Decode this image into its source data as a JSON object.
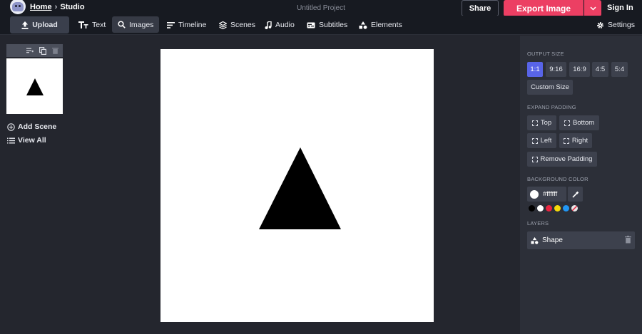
{
  "header": {
    "breadcrumb_home": "Home",
    "breadcrumb_separator": "›",
    "breadcrumb_current": "Studio",
    "project_title": "Untitled Project",
    "share_label": "Share",
    "export_label": "Export Image",
    "signin_label": "Sign In"
  },
  "toolbar": {
    "upload_label": "Upload",
    "items": [
      {
        "label": "Text",
        "icon": "text-icon"
      },
      {
        "label": "Images",
        "icon": "search-icon",
        "active": true
      },
      {
        "label": "Timeline",
        "icon": "timeline-icon"
      },
      {
        "label": "Scenes",
        "icon": "layers-icon"
      },
      {
        "label": "Audio",
        "icon": "music-note-icon"
      },
      {
        "label": "Subtitles",
        "icon": "subtitles-icon"
      },
      {
        "label": "Elements",
        "icon": "shapes-icon"
      }
    ],
    "settings_label": "Settings"
  },
  "scenes": {
    "add_scene_label": "Add Scene",
    "view_all_label": "View All"
  },
  "panel": {
    "output_size_label": "OUTPUT SIZE",
    "sizes": [
      "1:1",
      "9:16",
      "16:9",
      "4:5",
      "5:4"
    ],
    "selected_size": "1:1",
    "custom_size_label": "Custom Size",
    "expand_padding_label": "EXPAND PADDING",
    "padding_top": "Top",
    "padding_bottom": "Bottom",
    "padding_left": "Left",
    "padding_right": "Right",
    "remove_padding": "Remove Padding",
    "background_color_label": "BACKGROUND COLOR",
    "background_color_value": "#ffffff",
    "preset_colors": [
      "#000000",
      "#ffffff",
      "#e8233f",
      "#f5d90a",
      "#2196f3",
      "transparent"
    ],
    "layers_label": "LAYERS",
    "layers": [
      {
        "name": "Shape"
      }
    ]
  },
  "colors": {
    "accent": "#ec3f63",
    "selected": "#5864e8",
    "topbar": "#171a21",
    "panel": "#2c2f38"
  }
}
